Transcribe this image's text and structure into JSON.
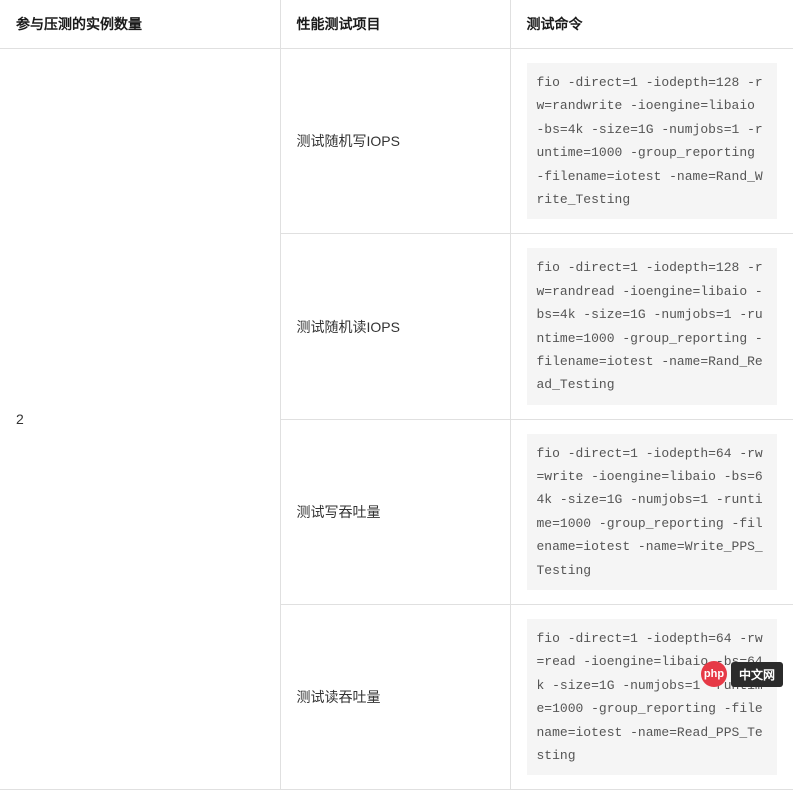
{
  "table": {
    "headers": {
      "count": "参与压测的实例数量",
      "item": "性能测试项目",
      "cmd": "测试命令"
    },
    "count_value": "2",
    "rows": [
      {
        "item": "测试随机写IOPS",
        "cmd": "fio -direct=1 -iodepth=128 -rw=randwrite -ioengine=libaio -bs=4k -size=1G -numjobs=1 -runtime=1000 -group_reporting -filename=iotest -name=Rand_Write_Testing"
      },
      {
        "item": "测试随机读IOPS",
        "cmd": "fio -direct=1 -iodepth=128 -rw=randread -ioengine=libaio -bs=4k -size=1G -numjobs=1 -runtime=1000 -group_reporting -filename=iotest -name=Rand_Read_Testing"
      },
      {
        "item": "测试写吞吐量",
        "cmd": "fio -direct=1 -iodepth=64 -rw=write -ioengine=libaio -bs=64k -size=1G -numjobs=1 -runtime=1000 -group_reporting -filename=iotest -name=Write_PPS_Testing"
      },
      {
        "item": "测试读吞吐量",
        "cmd": "fio -direct=1 -iodepth=64 -rw=read -ioengine=libaio -bs=64k -size=1G -numjobs=1 -runtime=1000 -group_reporting -filename=iotest -name=Read_PPS_Testing"
      }
    ]
  },
  "watermark": {
    "badge": "php",
    "text": "中文网"
  }
}
